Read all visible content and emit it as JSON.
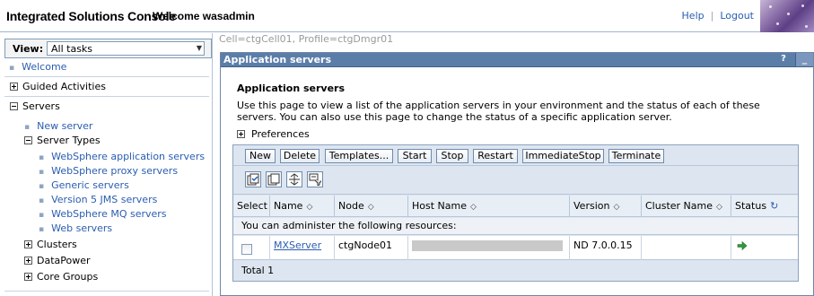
{
  "banner": {
    "title": "Integrated Solutions Console",
    "welcome": "Welcome wasadmin",
    "help": "Help",
    "logout": "Logout"
  },
  "nav": {
    "view_label": "View:",
    "view_value": "All tasks",
    "welcome": "Welcome",
    "guided_activities": "Guided Activities",
    "servers": "Servers",
    "new_server": "New server",
    "server_types": "Server Types",
    "server_type_items": [
      "WebSphere application servers",
      "WebSphere proxy servers",
      "Generic servers",
      "Version 5 JMS servers",
      "WebSphere MQ servers",
      "Web servers"
    ],
    "clusters": "Clusters",
    "datapower": "DataPower",
    "core_groups": "Core Groups"
  },
  "context": "Cell=ctgCell01, Profile=ctgDmgr01",
  "portlet": {
    "header": "Application servers",
    "help_icon": "?",
    "minimize": "_",
    "title": "Application servers",
    "description": "Use this page to view a list of the application servers in your environment and the status of each of these servers. You can also use this page to change the status of a specific application server.",
    "preferences": "Preferences"
  },
  "buttons": [
    "New",
    "Delete",
    "Templates...",
    "Start",
    "Stop",
    "Restart",
    "ImmediateStop",
    "Terminate"
  ],
  "icon_buttons": [
    "select-all-icon",
    "deselect-all-icon",
    "expand-icon",
    "filter-icon"
  ],
  "table": {
    "columns": [
      "Select",
      "Name",
      "Node",
      "Host Name",
      "Version",
      "Cluster Name",
      "Status"
    ],
    "admin_note": "You can administer the following resources:",
    "rows": [
      {
        "name": "MXServer",
        "node": "ctgNode01",
        "host": "",
        "version": "ND 7.0.0.15",
        "cluster": "",
        "status": "started-arrow-icon"
      }
    ],
    "total": "Total 1"
  },
  "colors": {
    "link": "#2a5db0",
    "header_bar": "#5b7ea9",
    "table_bg": "#dde6f0",
    "status_green": "#2e9b3a"
  }
}
